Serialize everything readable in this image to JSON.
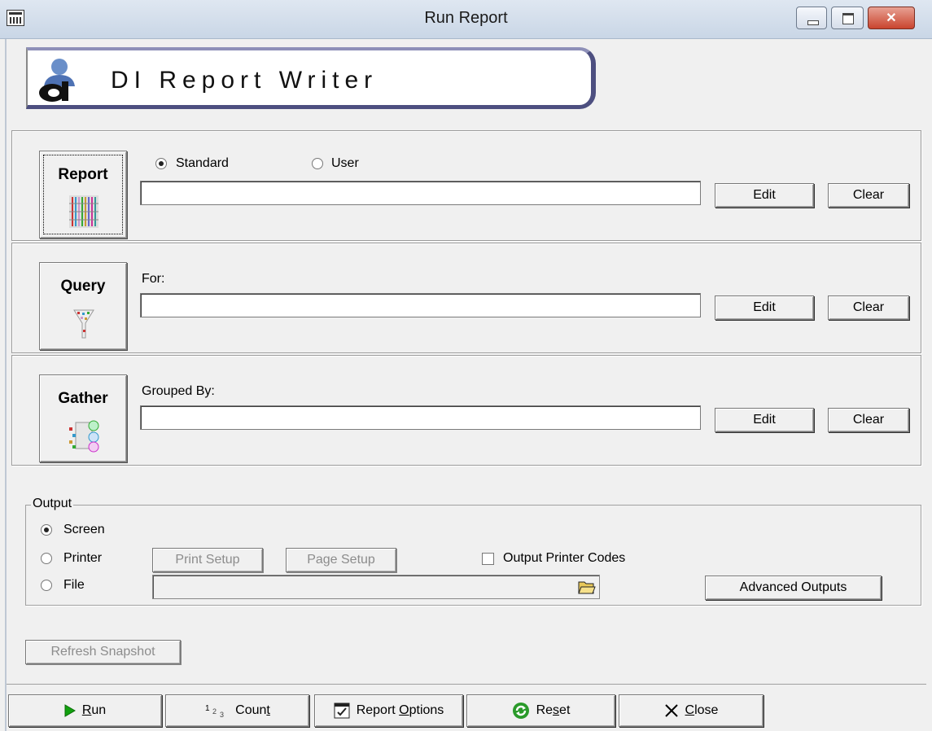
{
  "window": {
    "title": "Run Report"
  },
  "banner": {
    "text": "DI Report Writer"
  },
  "report_panel": {
    "button_label": "Report",
    "radio_standard": "Standard",
    "radio_user": "User",
    "selected": "Standard",
    "value": "",
    "edit_label": "Edit",
    "clear_label": "Clear"
  },
  "query_panel": {
    "button_label": "Query",
    "field_label": "For:",
    "value": "",
    "edit_label": "Edit",
    "clear_label": "Clear"
  },
  "gather_panel": {
    "button_label": "Gather",
    "field_label": "Grouped By:",
    "value": "",
    "edit_label": "Edit",
    "clear_label": "Clear"
  },
  "output": {
    "legend": "Output",
    "screen_label": "Screen",
    "printer_label": "Printer",
    "file_label": "File",
    "selected": "Screen",
    "print_setup_label": "Print Setup",
    "page_setup_label": "Page Setup",
    "printer_codes_label": "Output Printer Codes",
    "printer_codes_checked": false,
    "file_path": "",
    "advanced_label": "Advanced Outputs"
  },
  "refresh_label": "Refresh Snapshot",
  "bottom": {
    "run": {
      "pre": "",
      "key": "R",
      "post": "un"
    },
    "count": {
      "pre": "Coun",
      "key": "t",
      "post": ""
    },
    "options": {
      "pre": "Report ",
      "key": "O",
      "post": "ptions"
    },
    "reset": {
      "pre": "Re",
      "key": "s",
      "post": "et"
    },
    "close": {
      "pre": "",
      "key": "C",
      "post": "lose"
    }
  }
}
